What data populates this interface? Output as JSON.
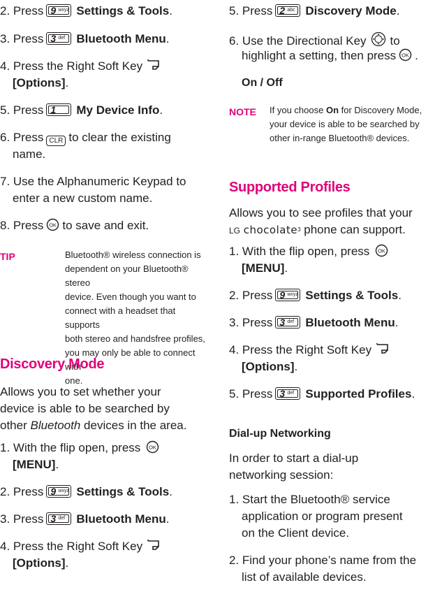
{
  "left": {
    "steps_a": [
      {
        "num": "2. Press",
        "key_digit": "9",
        "key_letters": "wxyz",
        "label": "Settings & Tools",
        "end": "."
      },
      {
        "num": "3. Press",
        "key_digit": "3",
        "key_letters": "def",
        "label": "Bluetooth Menu",
        "end": "."
      }
    ],
    "step4_line1": "4. Press the Right Soft Key",
    "step4_line2": "[Options]",
    "step4_end": ".",
    "step5": {
      "num": "5. Press",
      "key_digit": "1",
      "key_letters": "",
      "label": "My Device Info",
      "end": "."
    },
    "step6_pre": "6.  Press",
    "step6_key": "CLR",
    "step6_post": "to clear the existing",
    "step6_line2": "name.",
    "step7_line1": "7. Use the Alphanumeric Keypad to",
    "step7_line2": "enter a new custom name.",
    "step8_pre": "8. Press",
    "step8_post": "to save and exit.",
    "tip_label": "TIP",
    "tip_lines": [
      "Bluetooth® wireless connection is",
      "dependent on your Bluetooth® stereo",
      "device. Even though you want to",
      "connect with a headset that supports",
      "both stereo and handsfree profiles,",
      "you may only be able to connect with",
      "one."
    ],
    "discovery_heading": "Discovery Mode",
    "discovery_lines": [
      "Allows you to set whether your",
      "device is able to be searched by"
    ],
    "discovery_line3_pre": "other ",
    "discovery_line3_italic": "Bluetooth",
    "discovery_line3_post": " devices in the area.",
    "d_step1_line1": "1. With the flip open, press",
    "d_step1_line2": "[MENU]",
    "d_step1_end": ".",
    "d_step2": {
      "num": "2. Press",
      "key_digit": "9",
      "key_letters": "wxyz",
      "label": "Settings & Tools",
      "end": "."
    },
    "d_step3": {
      "num": "3. Press",
      "key_digit": "3",
      "key_letters": "def",
      "label": "Bluetooth Menu",
      "end": "."
    },
    "d_step4_line1": "4. Press the Right Soft Key",
    "d_step4_line2": "[Options]",
    "d_step4_end": "."
  },
  "right": {
    "step5": {
      "num": "5. Press",
      "key_digit": "2",
      "key_letters": "abc",
      "label": "Discovery Mode",
      "end": "."
    },
    "step6_line1": "6. Use the Directional Key",
    "step6_line1_post": "to",
    "step6_line2": "highlight a setting, then press",
    "step6_end": ".",
    "onoff": "On / Off",
    "note_label": "NOTE",
    "note_line1_pre": "If you choose ",
    "note_line1_bold": "On",
    "note_line1_post": " for Discovery Mode,",
    "note_lines": [
      "your device is able to be searched by",
      "other in-range Bluetooth® devices."
    ],
    "profiles_heading": "Supported Profiles",
    "profiles_line1": "Allows you to see profiles that your",
    "profiles_brand_lg": "LG",
    "profiles_brand_name": "chocolate",
    "profiles_brand_sup": "3",
    "profiles_line2_post": "phone can support.",
    "p_step1_line1": "1. With the flip open, press",
    "p_step1_line2": "[MENU]",
    "p_step1_end": ".",
    "p_step2": {
      "num": "2. Press",
      "key_digit": "9",
      "key_letters": "wxyz",
      "label": "Settings & Tools",
      "end": "."
    },
    "p_step3": {
      "num": "3. Press",
      "key_digit": "3",
      "key_letters": "def",
      "label": "Bluetooth Menu",
      "end": "."
    },
    "p_step4_line1": "4. Press the Right Soft Key",
    "p_step4_line2": "[Options]",
    "p_step4_end": ".",
    "p_step5": {
      "num": "5. Press",
      "key_digit": "3",
      "key_letters": "def",
      "label": "Supported Profiles",
      "end": "."
    },
    "dialup_heading": "Dial-up Networking",
    "dialup_intro": [
      "In order to start a dial-up",
      "networking session:"
    ],
    "dialup_step1": [
      "1. Start the Bluetooth® service",
      "application or program present",
      "on the Client device."
    ],
    "dialup_step2": [
      "2. Find your phone’s name from the",
      "list of available devices."
    ]
  },
  "icons": {
    "ok_key": "ok-key-icon",
    "soft_key": "right-soft-key-icon",
    "clr_key": "clr-key-icon",
    "nav_key": "directional-key-icon"
  }
}
